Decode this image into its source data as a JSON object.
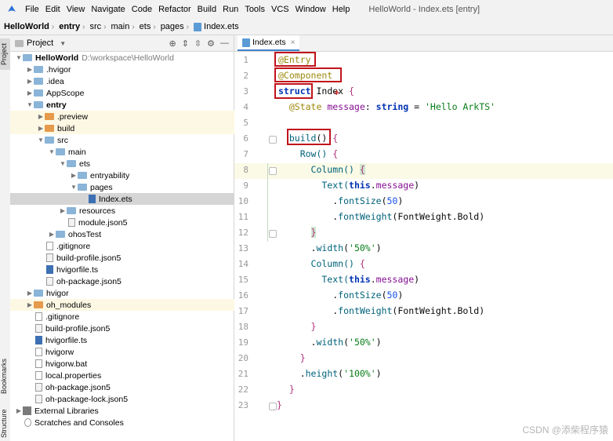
{
  "menubar": {
    "items": [
      "File",
      "Edit",
      "View",
      "Navigate",
      "Code",
      "Refactor",
      "Build",
      "Run",
      "Tools",
      "VCS",
      "Window",
      "Help"
    ],
    "window_title": "HelloWorld - Index.ets [entry]"
  },
  "breadcrumb": [
    "HelloWorld",
    "entry",
    "src",
    "main",
    "ets",
    "pages",
    "Index.ets"
  ],
  "side_tabs": {
    "project": "Project",
    "bookmarks": "Bookmarks",
    "structure": "Structure"
  },
  "project_panel": {
    "title": "Project",
    "root_path": "D:\\workspace\\HelloWorld",
    "tree": [
      {
        "label": "HelloWorld"
      },
      {
        "label": ".hvigor"
      },
      {
        "label": ".idea"
      },
      {
        "label": "AppScope"
      },
      {
        "label": "entry"
      },
      {
        "label": ".preview"
      },
      {
        "label": "build"
      },
      {
        "label": "src"
      },
      {
        "label": "main"
      },
      {
        "label": "ets"
      },
      {
        "label": "entryability"
      },
      {
        "label": "pages"
      },
      {
        "label": "Index.ets"
      },
      {
        "label": "resources"
      },
      {
        "label": "module.json5"
      },
      {
        "label": "ohosTest"
      },
      {
        "label": ".gitignore"
      },
      {
        "label": "build-profile.json5"
      },
      {
        "label": "hvigorfile.ts"
      },
      {
        "label": "oh-package.json5"
      },
      {
        "label": "hvigor"
      },
      {
        "label": "oh_modules"
      },
      {
        "label": ".gitignore"
      },
      {
        "label": "build-profile.json5"
      },
      {
        "label": "hvigorfile.ts"
      },
      {
        "label": "hvigorw"
      },
      {
        "label": "hvigorw.bat"
      },
      {
        "label": "local.properties"
      },
      {
        "label": "oh-package.json5"
      },
      {
        "label": "oh-package-lock.json5"
      },
      {
        "label": "External Libraries"
      },
      {
        "label": "Scratches and Consoles"
      }
    ]
  },
  "editor": {
    "tab_label": "Index.ets",
    "line_numbers": [
      "1",
      "2",
      "3",
      "4",
      "5",
      "6",
      "7",
      "8",
      "9",
      "10",
      "11",
      "12",
      "13",
      "14",
      "15",
      "16",
      "17",
      "18",
      "19",
      "20",
      "21",
      "22",
      "23"
    ],
    "tokens": {
      "l1": "@Entry",
      "l2": "@Component",
      "l3a": "struct",
      "l3b": " Index ",
      "l3c": "{",
      "l4a": "  @State ",
      "l4b": "message",
      "l4c": ": ",
      "l4d": "string",
      "l4e": " = ",
      "l4f": "'Hello ArkTS'",
      "l6a": "  ",
      "l6b": "build",
      "l6c": "() ",
      "l6d": "{",
      "l7a": "    Row() ",
      "l7b": "{",
      "l8a": "      Column() ",
      "l8b": "{",
      "l9a": "        Text(",
      "l9b": "this",
      "l9c": ".",
      "l9d": "message",
      "l9e": ")",
      "l10a": "          .",
      "l10b": "fontSize",
      "l10c": "(",
      "l10d": "50",
      "l10e": ")",
      "l11a": "          .",
      "l11b": "fontWeight",
      "l11c": "(FontWeight.Bold)",
      "l12a": "      ",
      "l12b": "}",
      "l13a": "      .",
      "l13b": "width",
      "l13c": "(",
      "l13d": "'50%'",
      "l13e": ")",
      "l14a": "      Column() ",
      "l14b": "{",
      "l15a": "        Text(",
      "l15b": "this",
      "l15c": ".",
      "l15d": "message",
      "l15e": ")",
      "l16a": "          .",
      "l16b": "fontSize",
      "l16c": "(",
      "l16d": "50",
      "l16e": ")",
      "l17a": "          .",
      "l17b": "fontWeight",
      "l17c": "(FontWeight.Bold)",
      "l18a": "      ",
      "l18b": "}",
      "l19a": "      .",
      "l19b": "width",
      "l19c": "(",
      "l19d": "'50%'",
      "l19e": ")",
      "l20a": "    ",
      "l20b": "}",
      "l21a": "    .",
      "l21b": "height",
      "l21c": "(",
      "l21d": "'100%'",
      "l21e": ")",
      "l22a": "  ",
      "l22b": "}",
      "l23": "}"
    }
  },
  "watermark": "CSDN @添柴程序猿",
  "colors": {
    "keyword": "#0033b3",
    "decorator": "#9e880d",
    "string": "#067d17",
    "number": "#1750eb",
    "annotation_box": "#c0141c",
    "selection": "#d5d5d5"
  }
}
